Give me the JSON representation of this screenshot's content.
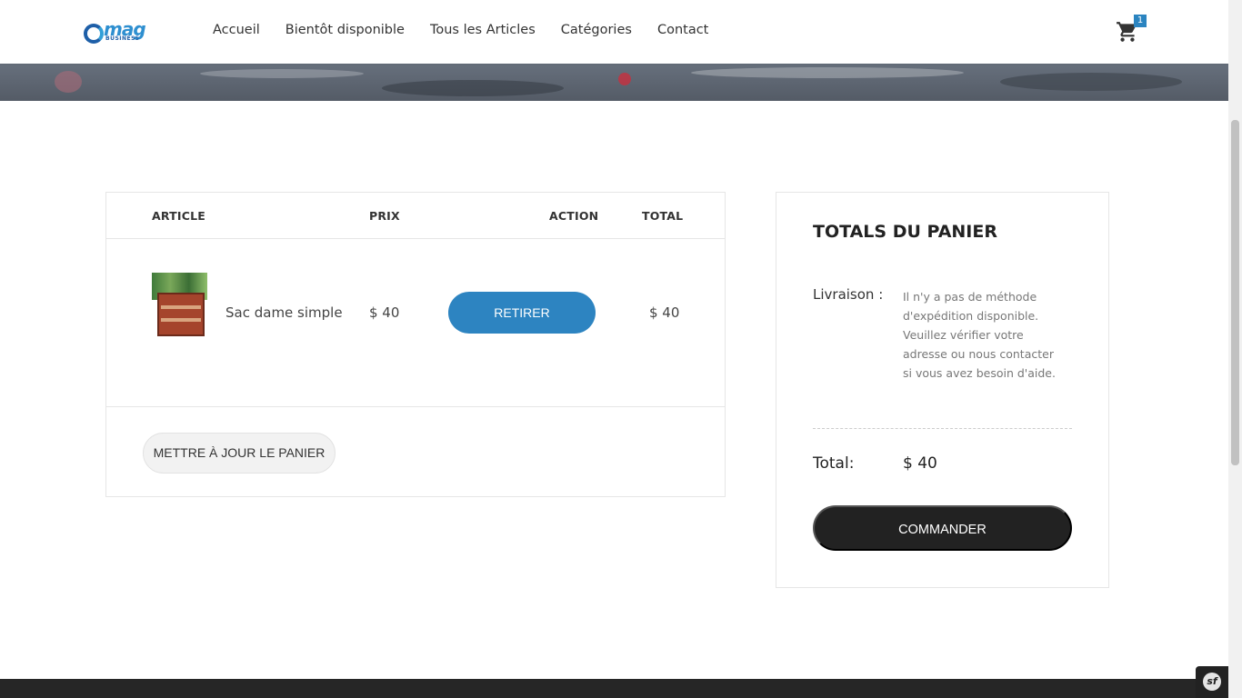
{
  "header": {
    "logo_text": "mag",
    "logo_subtext": "BUSINESS",
    "nav": [
      {
        "label": "Accueil"
      },
      {
        "label": "Bientôt disponible"
      },
      {
        "label": "Tous les Articles"
      },
      {
        "label": "Catégories"
      },
      {
        "label": "Contact"
      }
    ],
    "cart_count": "1"
  },
  "cart": {
    "columns": {
      "article": "ARTICLE",
      "price": "PRIX",
      "action": "ACTION",
      "total": "TOTAL"
    },
    "items": [
      {
        "name": "Sac dame simple",
        "price": "$ 40",
        "action_label": "RETIRER",
        "total": "$ 40"
      }
    ],
    "update_label": "METTRE À JOUR LE PANIER"
  },
  "totals": {
    "title": "TOTALS DU PANIER",
    "shipping_label": "Livraison :",
    "shipping_message": "Il n'y a pas de méthode d'expédition disponible. Veuillez vérifier votre adresse ou nous contacter si vous avez besoin d'aide.",
    "total_label": "Total:",
    "total_value": "$ 40",
    "checkout_label": "COMMANDER"
  },
  "colors": {
    "accent": "#2d84c1",
    "dark_button": "#222222",
    "footer": "#262626"
  },
  "icons": {
    "cart": "shopping-cart-icon",
    "debug_toolbar": "symfony-icon"
  }
}
